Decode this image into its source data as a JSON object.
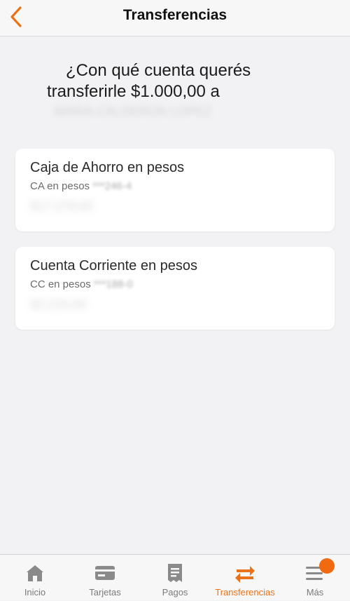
{
  "colors": {
    "accent": "#e8731b",
    "badge": "#f26a10",
    "tab_inactive": "#7a7a7a"
  },
  "header": {
    "title": "Transferencias",
    "back_icon": "chevron-left-icon"
  },
  "question": {
    "line1": "¿Con qué cuenta querés",
    "line2": "transferirle $1.000,00 a",
    "line3": "MARIA CALDERON LOPEZ"
  },
  "accounts": [
    {
      "title": "Caja de Ahorro en pesos",
      "subtitle_prefix": "CA en pesos",
      "subtitle_masked": "***246-4",
      "balance": "$17.379,60"
    },
    {
      "title": "Cuenta Corriente en pesos",
      "subtitle_prefix": "CC en pesos",
      "subtitle_masked": "***188-0",
      "balance": "$3.215,00"
    }
  ],
  "tabbar": {
    "items": [
      {
        "label": "Inicio",
        "icon": "home-icon",
        "active": false
      },
      {
        "label": "Tarjetas",
        "icon": "card-icon",
        "active": false
      },
      {
        "label": "Pagos",
        "icon": "receipt-icon",
        "active": false
      },
      {
        "label": "Transferencias",
        "icon": "transfer-arrows-icon",
        "active": true
      },
      {
        "label": "Más",
        "icon": "menu-icon",
        "active": false,
        "has_badge": true
      }
    ]
  }
}
